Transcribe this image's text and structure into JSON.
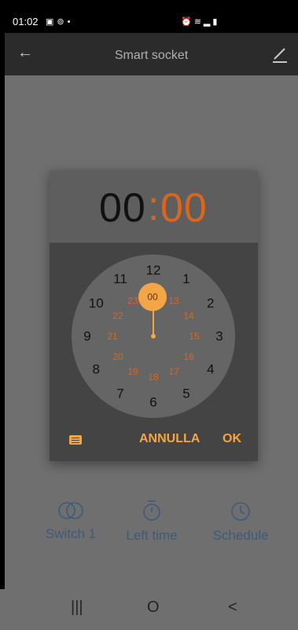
{
  "status_bar": {
    "time": "01:02",
    "left_icons": [
      "gallery-icon",
      "hotspot-icon",
      "dots-icon"
    ],
    "right_icons": [
      "alarm-icon",
      "wifi-icon",
      "signal-icon",
      "battery-icon"
    ]
  },
  "app_bar": {
    "title": "Smart socket",
    "back_icon": "arrow-left-icon",
    "edit_icon": "pencil-icon"
  },
  "time_picker": {
    "hours": "00",
    "separator": ":",
    "minutes": "00",
    "selected_label": "00",
    "outer_numbers": [
      "12",
      "1",
      "2",
      "3",
      "4",
      "5",
      "6",
      "7",
      "8",
      "9",
      "10",
      "11"
    ],
    "inner_numbers": [
      "00",
      "13",
      "14",
      "15",
      "16",
      "17",
      "18",
      "19",
      "20",
      "21",
      "22",
      "23"
    ],
    "keyboard_icon": "keyboard-icon",
    "cancel_label": "ANNULLA",
    "ok_label": "OK"
  },
  "bottom_actions": [
    {
      "label": "Switch 1",
      "icon": "toggle-circles-icon"
    },
    {
      "label": "Left time",
      "icon": "timer-icon"
    },
    {
      "label": "Schedule",
      "icon": "clock-icon"
    }
  ],
  "nav_bar": {
    "recents": "|||",
    "home": "O",
    "back": "<"
  },
  "colors": {
    "accent": "#f4a546",
    "minutes": "#d9661f",
    "scrim": "#6f6f6f",
    "bottom_text": "#3e5a7a"
  }
}
